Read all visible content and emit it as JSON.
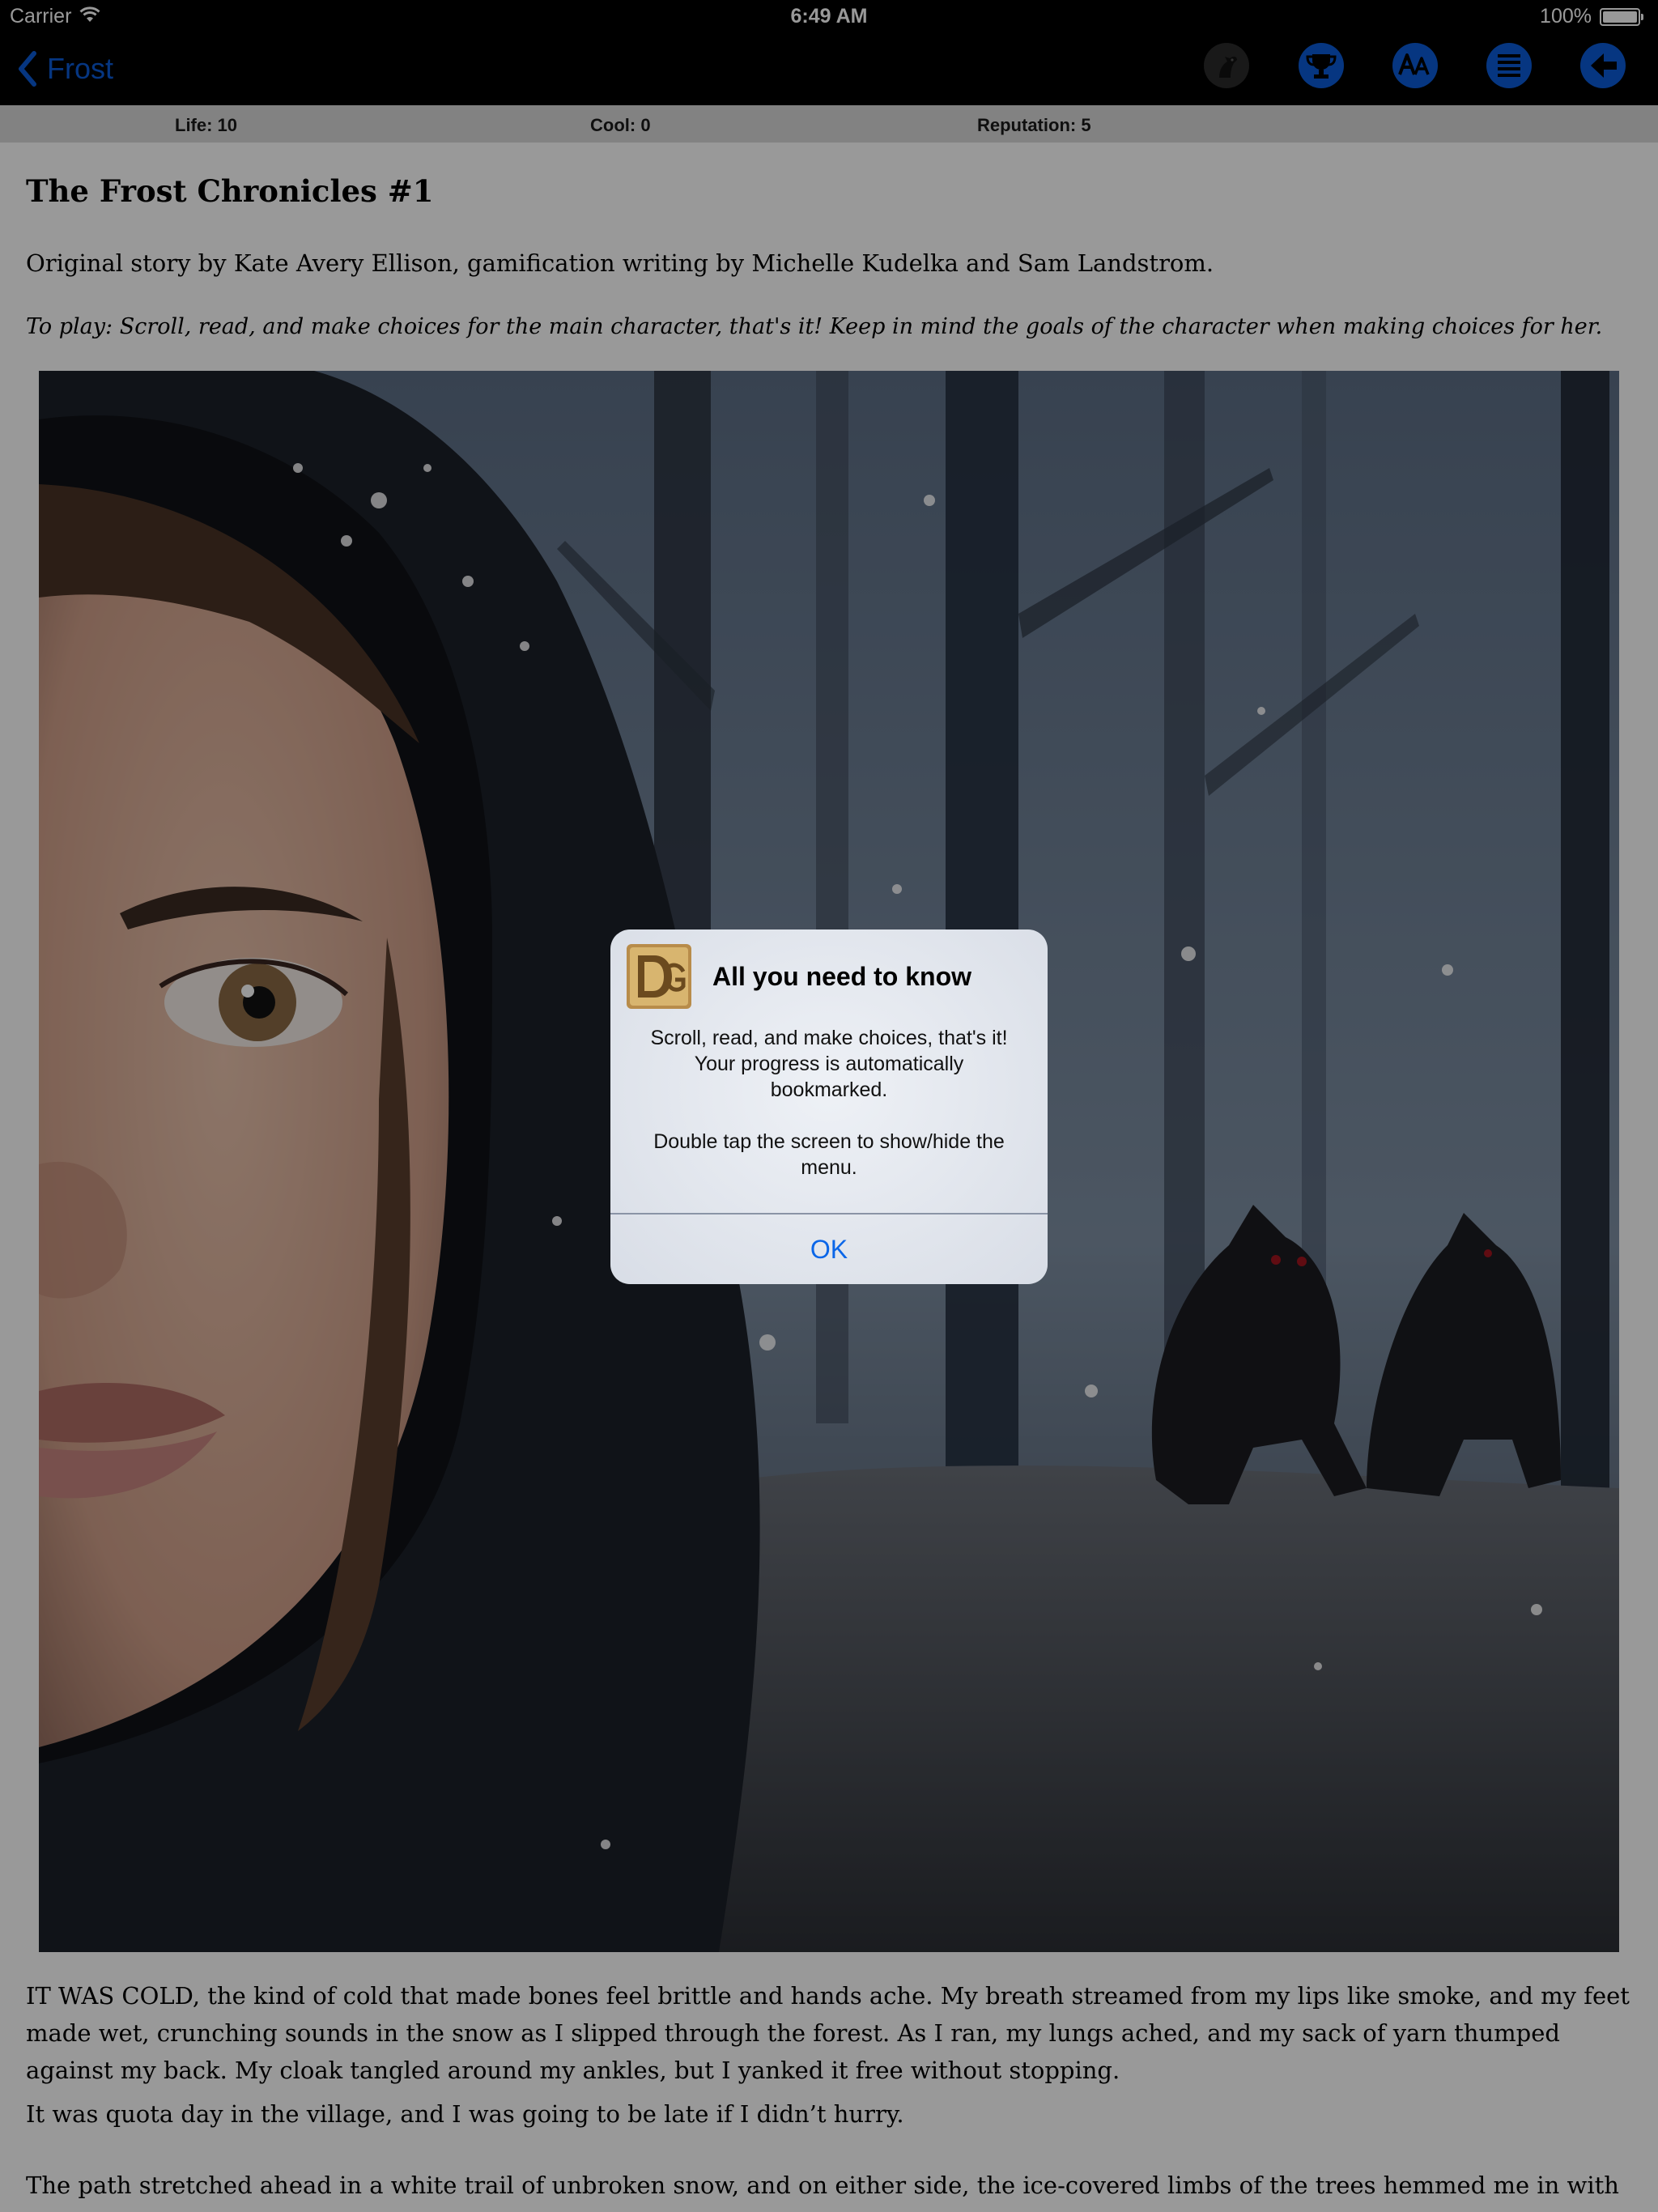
{
  "status_bar": {
    "carrier": "Carrier",
    "time": "6:49 AM",
    "battery": "100%"
  },
  "nav": {
    "back_label": "Frost",
    "icons": [
      "horse-icon",
      "trophy-icon",
      "font-size-icon",
      "list-icon",
      "back-arrow-icon"
    ],
    "accent_color": "#0a5bd8"
  },
  "stats": {
    "life": "Life: 10",
    "cool": "Cool: 0",
    "reputation": "Reputation: 5"
  },
  "story": {
    "title": "The Frost Chronicles #1",
    "byline": "Original story by Kate Avery Ellison, gamification writing by Michelle Kudelka and Sam Landstrom.",
    "instructions": "To play: Scroll, read, and make choices for the main character, that's it! Keep in mind the goals of the character when making choices for her.",
    "paragraphs": [
      "IT WAS COLD, the kind of cold that made bones feel brittle and hands ache. My breath streamed from my lips like smoke, and my feet made wet, crunching sounds in the snow as I slipped through the forest. As I ran, my lungs ached, and my sack of yarn thumped against my back. My cloak tangled around my ankles, but I yanked it free without stopping.",
      "It was quota day in the village, and I was going to be late if I didn’t hurry.",
      "The path stretched ahead in a white trail of unbroken snow, and on either side, the ice-covered limbs of the trees hemmed me in with walls"
    ]
  },
  "alert": {
    "title": "All you need to know",
    "message_1": "Scroll, read, and make choices, that's it! Your progress is automatically bookmarked.",
    "message_2": "Double tap the screen to show/hide the menu.",
    "ok_label": "OK",
    "logo_icon": "dg-logo-icon"
  }
}
